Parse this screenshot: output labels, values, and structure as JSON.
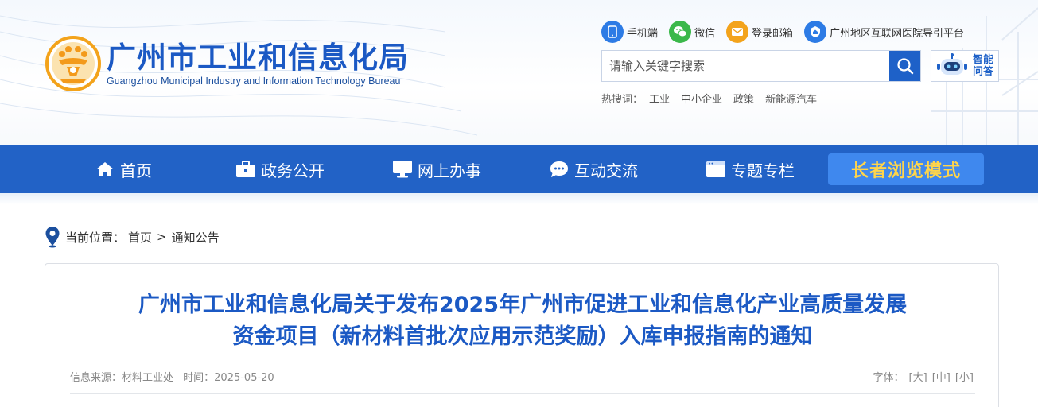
{
  "header": {
    "site_name_cn": "广州市工业和信息化局",
    "site_name_en": "Guangzhou Municipal Industry and Information Technology Bureau",
    "quick_links": [
      {
        "label": "手机端",
        "icon": "mobile-icon",
        "color": "#2d7be5"
      },
      {
        "label": "微信",
        "icon": "wechat-icon",
        "color": "#3bb84a"
      },
      {
        "label": "登录邮箱",
        "icon": "mail-icon",
        "color": "#f3a31b"
      },
      {
        "label": "广州地区互联网医院导引平台",
        "icon": "hospital-shield-icon",
        "color": "#2d7be5"
      }
    ],
    "search": {
      "placeholder": "请输入关键字搜索"
    },
    "ai_assistant": {
      "label": "智能问答"
    },
    "hot_search": {
      "title": "热搜词：",
      "items": [
        "工业",
        "中小企业",
        "政策",
        "新能源汽车"
      ]
    }
  },
  "nav": {
    "items": [
      {
        "label": "首页",
        "icon": "home-icon"
      },
      {
        "label": "政务公开",
        "icon": "briefcase-icon"
      },
      {
        "label": "网上办事",
        "icon": "monitor-icon"
      },
      {
        "label": "互动交流",
        "icon": "chat-icon"
      },
      {
        "label": "专题专栏",
        "icon": "window-icon"
      }
    ],
    "elder_mode": "长者浏览模式"
  },
  "breadcrumb": {
    "prefix": "当前位置：",
    "items": [
      "首页",
      "通知公告"
    ],
    "separator": ">"
  },
  "article": {
    "title_line1": "广州市工业和信息化局关于发布2025年广州市促进工业和信息化产业高质量发展",
    "title_line2": "资金项目（新材料首批次应用示范奖励）入库申报指南的通知",
    "source_label": "信息来源：材料工业处",
    "time_label": "时间：2025-05-20",
    "font_label": "字体：",
    "font_sizes": [
      "[大]",
      "[中]",
      "[小]"
    ]
  },
  "colors": {
    "brand_blue": "#1b59c4",
    "nav_blue": "#2262c6",
    "elder_gold": "#ffd54a"
  }
}
